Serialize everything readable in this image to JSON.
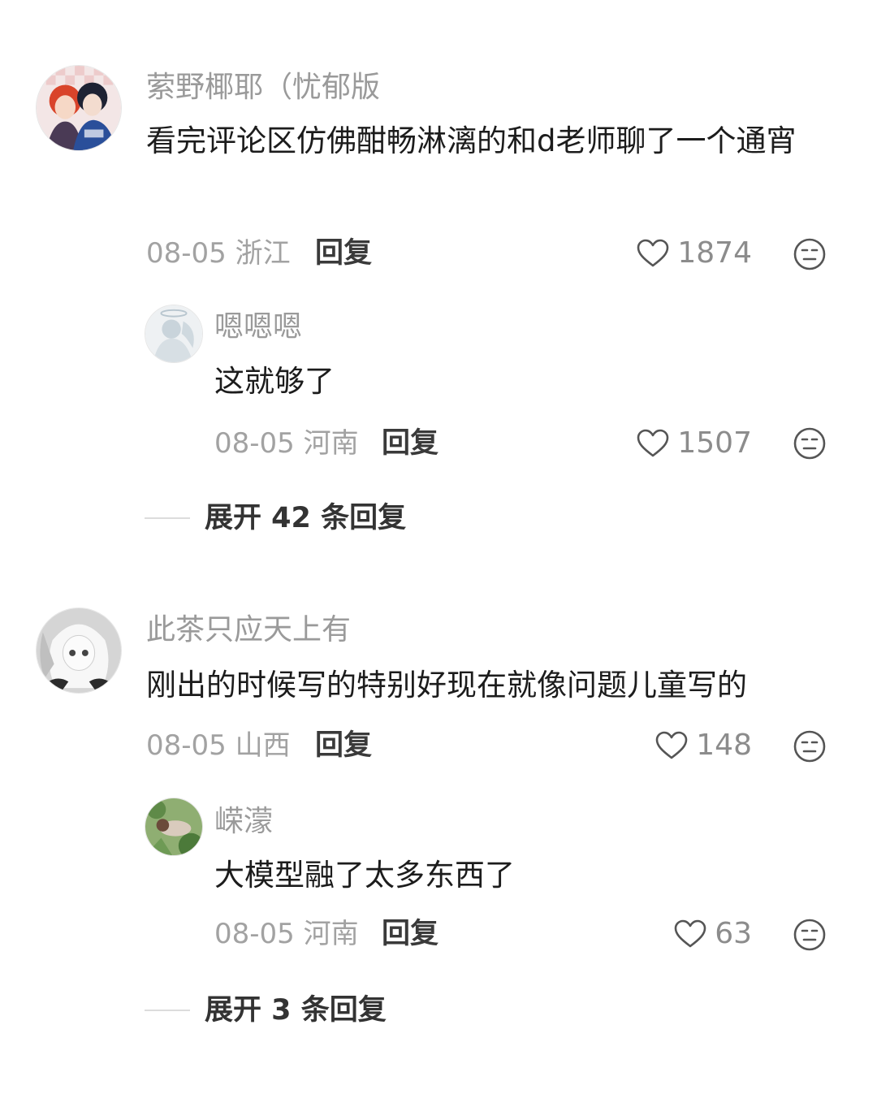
{
  "comments": [
    {
      "username": "萦野椰耶（忧郁版",
      "text": "看完评论区仿佛酣畅淋漓的和d老师聊了一个通宵",
      "date_location": "08-05 浙江",
      "reply_label": "回复",
      "likes": "1874",
      "avatar_icon": "anime-avatar",
      "reply": {
        "username": "嗯嗯嗯",
        "text": "这就够了",
        "date_location": "08-05 河南",
        "reply_label": "回复",
        "likes": "1507",
        "avatar_icon": "angel-avatar"
      },
      "expand_label": "展开 42 条回复"
    },
    {
      "username": "此茶只应天上有",
      "text": "刚出的时候写的特别好现在就像问题儿童写的",
      "date_location": "08-05 山西",
      "reply_label": "回复",
      "likes": "148",
      "avatar_icon": "white-hair-anime-avatar",
      "reply": {
        "username": "嵘濛",
        "text": "大模型融了太多东西了",
        "date_location": "08-05 河南",
        "reply_label": "回复",
        "likes": "63",
        "avatar_icon": "nature-avatar"
      },
      "expand_label": "展开 3 条回复"
    }
  ],
  "icons": {
    "like": "heart-icon",
    "dislike": "dislike-face-icon"
  },
  "colors": {
    "username": "#9a9a9a",
    "text": "#1c1c1c",
    "meta": "#a2a2a2"
  }
}
